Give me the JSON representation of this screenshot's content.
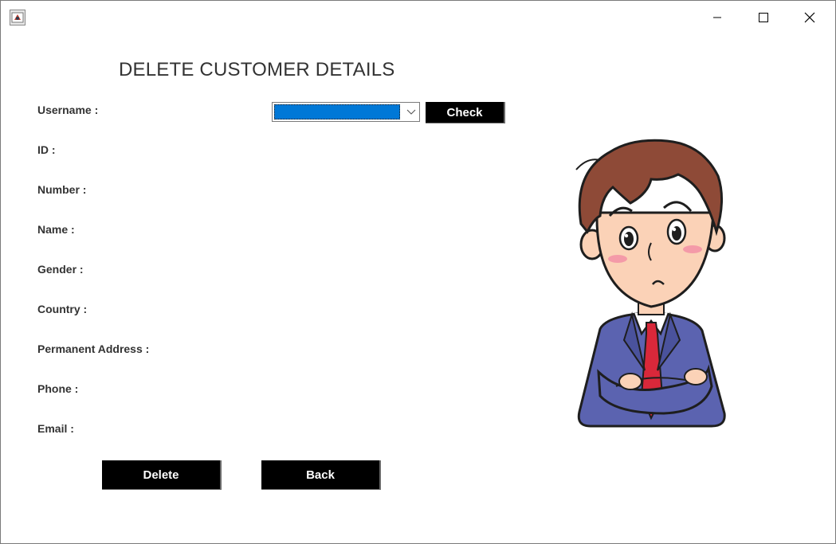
{
  "window": {
    "controls": [
      "minimize-icon",
      "maximize-icon",
      "close-icon"
    ]
  },
  "page": {
    "title": "DELETE CUSTOMER DETAILS"
  },
  "form": {
    "username_label": "Username :",
    "id_label": "ID :",
    "number_label": "Number :",
    "name_label": "Name :",
    "gender_label": "Gender :",
    "country_label": "Country :",
    "address_label": "Permanent Address :",
    "phone_label": "Phone :",
    "email_label": "Email :",
    "username_selected": ""
  },
  "buttons": {
    "check": "Check",
    "delete": "Delete",
    "back": "Back"
  },
  "colors": {
    "selection": "#0078d7",
    "button_bg": "#000000",
    "button_text": "#ffffff"
  }
}
